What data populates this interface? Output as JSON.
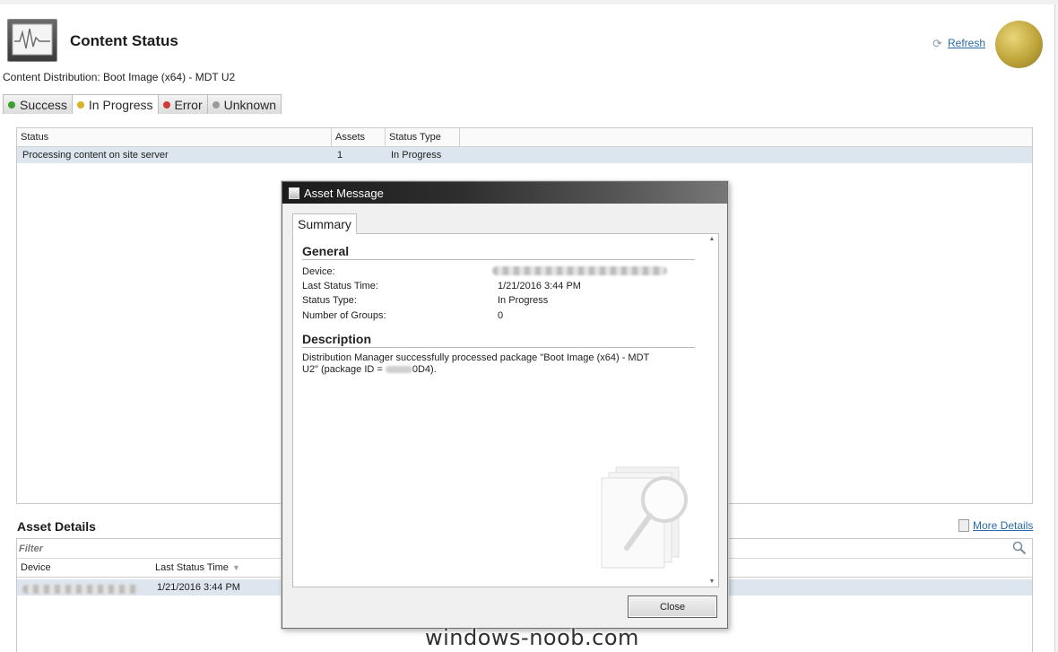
{
  "header": {
    "title": "Content Status",
    "subtitle": "Content Distribution: Boot Image (x64) - MDT U2",
    "refresh_label": "Refresh",
    "icon": "monitor-heartbeat-icon"
  },
  "tabs": [
    {
      "label": "Success",
      "color": "#3aa02c"
    },
    {
      "label": "In Progress",
      "color": "#d8b228"
    },
    {
      "label": "Error",
      "color": "#d03a3a"
    },
    {
      "label": "Unknown",
      "color": "#9a9a9a"
    }
  ],
  "status_grid": {
    "columns": [
      "Status",
      "Assets",
      "Status Type"
    ],
    "rows": [
      {
        "status": "Processing content on site server",
        "assets": "1",
        "status_type": "In Progress"
      }
    ]
  },
  "asset_details": {
    "title": "Asset Details",
    "more_details_label": "More Details",
    "filter_placeholder": "Filter",
    "columns": [
      "Device",
      "Last Status Time"
    ],
    "rows": [
      {
        "last_status_time": "1/21/2016 3:44 PM"
      }
    ]
  },
  "dialog": {
    "title": "Asset Message",
    "tab": "Summary",
    "general_heading": "General",
    "fields": [
      {
        "label": "Device:",
        "value": ""
      },
      {
        "label": "Last Status Time:",
        "value": "1/21/2016 3:44 PM"
      },
      {
        "label": "Status Type:",
        "value": "In Progress"
      },
      {
        "label": "Number of Groups:",
        "value": "0"
      }
    ],
    "description_heading": "Description",
    "description_part1": "Distribution Manager successfully processed package \"Boot Image (x64) - MDT U2\" (package ID = ",
    "description_part2": "0D4).",
    "close_label": "Close"
  },
  "watermark": "windows-noob.com"
}
